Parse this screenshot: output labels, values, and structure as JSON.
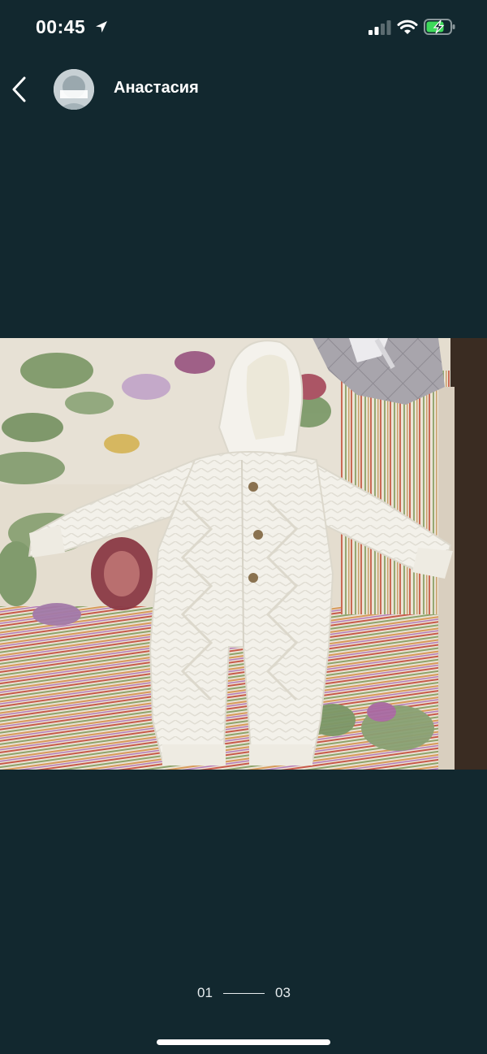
{
  "status_bar": {
    "time": "00:45",
    "icons": [
      "location-arrow-icon",
      "signal-icon",
      "wifi-icon",
      "battery-charging-icon"
    ]
  },
  "header": {
    "back_icon": "chevron-left-icon",
    "user_name": "Анастасия"
  },
  "photo": {
    "subject": "photo-knitted-baby-jumpsuit"
  },
  "pager": {
    "current": "01",
    "total": "03"
  },
  "colors": {
    "background": "#12282f",
    "text": "#ffffff"
  }
}
